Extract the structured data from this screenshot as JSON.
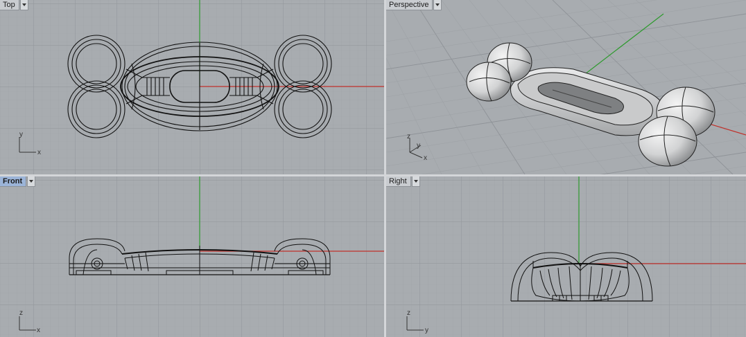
{
  "viewports": {
    "top": {
      "label": "Top",
      "axes": {
        "a": "y",
        "b": "x"
      }
    },
    "perspective": {
      "label": "Perspective",
      "axes": {
        "a": "z",
        "b": "y",
        "c": "x"
      }
    },
    "front": {
      "label": "Front",
      "axes": {
        "a": "z",
        "b": "x"
      },
      "active": true
    },
    "right": {
      "label": "Right",
      "axes": {
        "a": "z",
        "b": "y"
      }
    }
  },
  "colors": {
    "background": "#a8acb0",
    "grid_minor": "#9ea2a6",
    "grid_major": "#8f9398",
    "axis_x": "#c0302a",
    "axis_y": "#2e9a2e",
    "wire": "#111111",
    "active_tab": "#9bb4d8"
  }
}
